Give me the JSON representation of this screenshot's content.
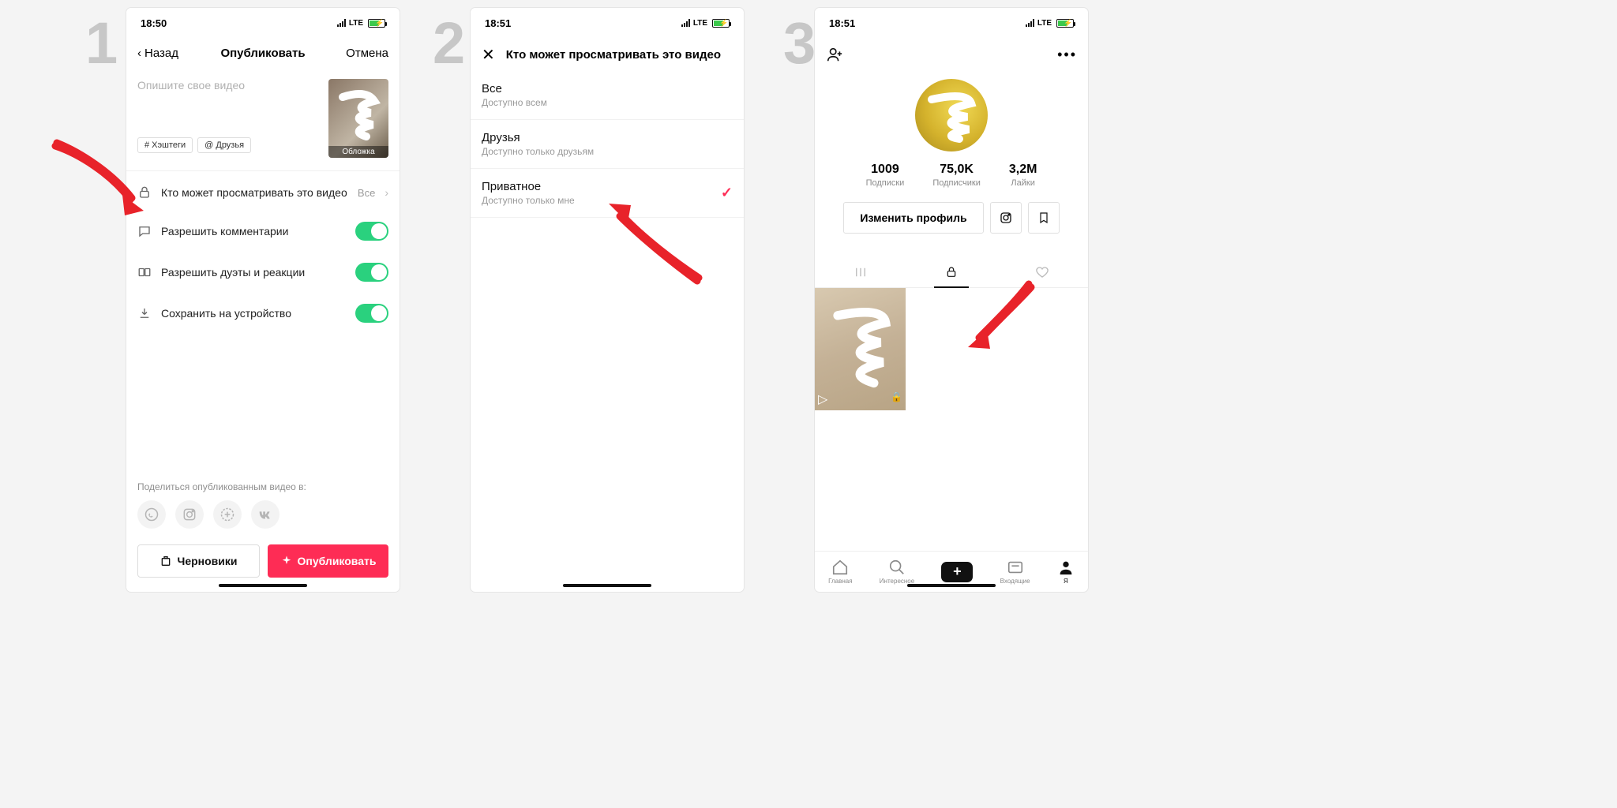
{
  "step_numbers": [
    "1",
    "2",
    "3"
  ],
  "status": {
    "time1": "18:50",
    "time2": "18:51",
    "time3": "18:51",
    "net": "LTE"
  },
  "screen1": {
    "back": "Назад",
    "title": "Опубликовать",
    "cancel": "Отмена",
    "placeholder": "Опишите свое видео",
    "chip_tags": "# Хэштеги",
    "chip_friends": "@ Друзья",
    "cover_label": "Обложка",
    "privacy": {
      "label": "Кто может просматривать это видео",
      "value": "Все"
    },
    "comments": "Разрешить комментарии",
    "duets": "Разрешить дуэты и реакции",
    "save": "Сохранить на устройство",
    "share_label": "Поделиться опубликованным видео в:",
    "drafts": "Черновики",
    "publish": "Опубликовать"
  },
  "screen2": {
    "title": "Кто может просматривать это видео",
    "options": [
      {
        "title": "Все",
        "sub": "Доступно всем",
        "selected": false
      },
      {
        "title": "Друзья",
        "sub": "Доступно только друзьям",
        "selected": false
      },
      {
        "title": "Приватное",
        "sub": "Доступно только мне",
        "selected": true
      }
    ]
  },
  "screen3": {
    "stats": [
      {
        "n": "1009",
        "l": "Подписки"
      },
      {
        "n": "75,0K",
        "l": "Подписчики"
      },
      {
        "n": "3,2M",
        "l": "Лайки"
      }
    ],
    "edit": "Изменить профиль",
    "nav": {
      "home": "Главная",
      "discover": "Интересное",
      "inbox": "Входящие",
      "me": "Я"
    }
  }
}
